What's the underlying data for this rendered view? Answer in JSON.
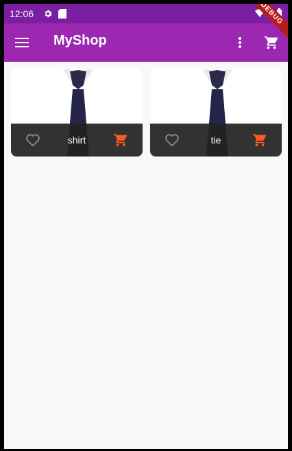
{
  "status_bar": {
    "time": "12:06",
    "icons": [
      "settings-icon",
      "sd-card-icon",
      "wifi-icon",
      "signal-icon",
      "battery-icon"
    ]
  },
  "app_bar": {
    "title": "MyShop",
    "menu_icon": "menu-icon",
    "more_icon": "more-vert-icon",
    "cart_icon": "shopping-cart-icon"
  },
  "debug_banner": "DEBUG",
  "products": [
    {
      "title": "shirt",
      "favorite_icon": "heart-outline-icon",
      "cart_icon": "cart-icon"
    },
    {
      "title": "tie",
      "favorite_icon": "heart-outline-icon",
      "cart_icon": "cart-icon"
    }
  ],
  "colors": {
    "app_bar": "#9c27b0",
    "status_bar": "#7b1fa2",
    "accent": "#ff5722",
    "footer": "#222222"
  }
}
